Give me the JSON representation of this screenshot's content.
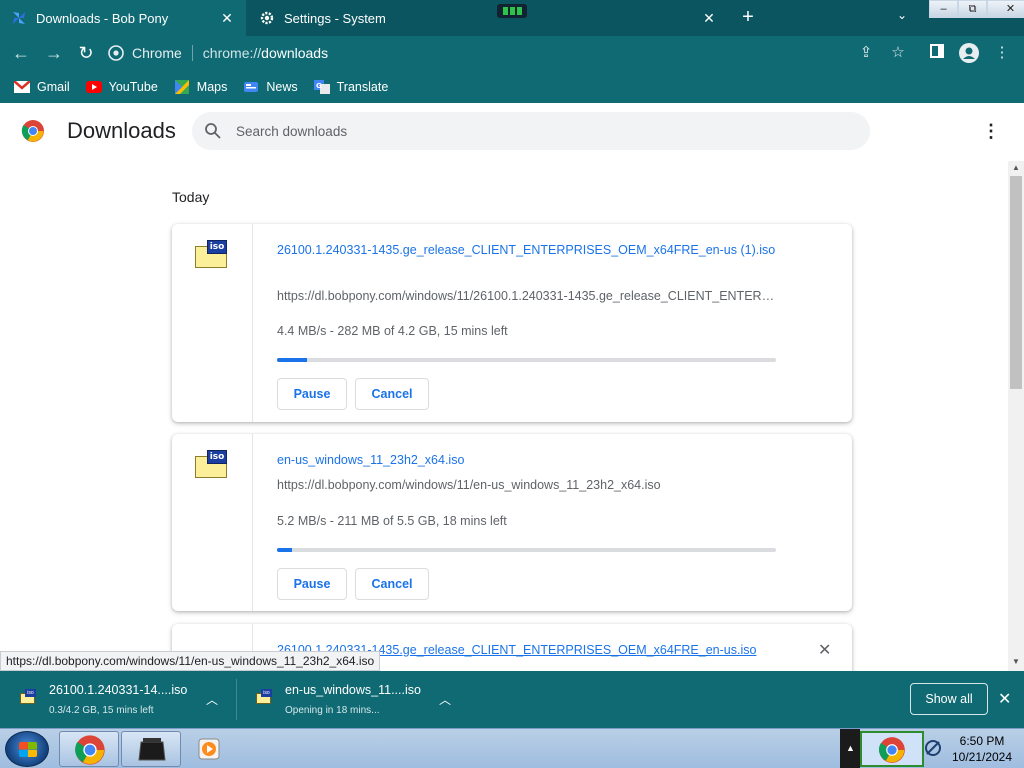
{
  "tabs": [
    {
      "title": "Downloads - Bob Pony",
      "icon": "pinwheel-icon",
      "active": true
    },
    {
      "title": "Settings - System",
      "icon": "gear-icon",
      "active": false
    }
  ],
  "window_controls": {
    "minimize": "–",
    "restore": "⧉",
    "close": "✕"
  },
  "omnibox": {
    "site_label": "Chrome",
    "url_scheme": "chrome://",
    "url_path": "downloads"
  },
  "bookmarks": [
    {
      "label": "Gmail",
      "icon": "gmail-icon"
    },
    {
      "label": "YouTube",
      "icon": "youtube-icon"
    },
    {
      "label": "Maps",
      "icon": "maps-icon"
    },
    {
      "label": "News",
      "icon": "news-icon"
    },
    {
      "label": "Translate",
      "icon": "translate-icon"
    }
  ],
  "page": {
    "title": "Downloads",
    "search_placeholder": "Search downloads",
    "section_label": "Today"
  },
  "downloads": [
    {
      "file_name": "26100.1.240331-1435.ge_release_CLIENT_ENTERPRISES_OEM_x64FRE_en-us (1).iso",
      "url": "https://dl.bobpony.com/windows/11/26100.1.240331-1435.ge_release_CLIENT_ENTERPRISES_OEM_x64FRE_en-us (1).iso",
      "status": "4.4 MB/s - 282 MB of 4.2 GB, 15 mins left",
      "progress": 0.06,
      "pause_label": "Pause",
      "cancel_label": "Cancel"
    },
    {
      "file_name": "en-us_windows_11_23h2_x64.iso",
      "url": "https://dl.bobpony.com/windows/11/en-us_windows_11_23h2_x64.iso",
      "status": "5.2 MB/s - 211 MB of 5.5 GB, 18 mins left",
      "progress": 0.03,
      "pause_label": "Pause",
      "cancel_label": "Cancel"
    },
    {
      "file_name": "26100.1.240331-1435.ge_release_CLIENT_ENTERPRISES_OEM_x64FRE_en-us.iso"
    }
  ],
  "status_bar_url": "https://dl.bobpony.com/windows/11/en-us_windows_11_23h2_x64.iso",
  "shelf": {
    "items": [
      {
        "name": "26100.1.240331-14....iso",
        "status": "0.3/4.2 GB, 15 mins left"
      },
      {
        "name": "en-us_windows_11....iso",
        "status": "Opening in 18 mins..."
      }
    ],
    "show_all_label": "Show all"
  },
  "taskbar": {
    "clock_time": "6:50 PM",
    "clock_date": "10/21/2024"
  },
  "colors": {
    "frame": "#0f6a73",
    "accent": "#1a73e8",
    "tab_strip": "#0b5560"
  }
}
